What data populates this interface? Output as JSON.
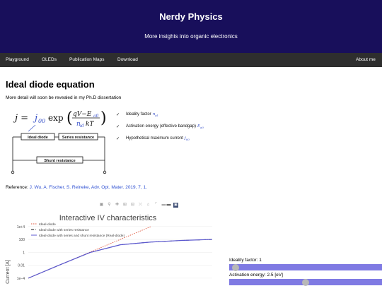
{
  "header": {
    "title": "Nerdy Physics",
    "subtitle": "More insights into organic electronics"
  },
  "nav": {
    "items": [
      "Playground",
      "OLEDs",
      "Publication Maps",
      "Download"
    ],
    "about": "About me"
  },
  "main": {
    "title": "Ideal diode equation",
    "intro": "More detail will soon be revealed in my Ph.D dissertation",
    "equation": {
      "lhs": "j = ",
      "prefactor": "j",
      "prefactor_sub": "00",
      "exp": "exp",
      "numerator": "qV−E",
      "numerator_sub": "a0",
      "denominator": "n",
      "denominator_sub": "id",
      "denominator_tail": "kT"
    },
    "circuit": {
      "ideal_diode": "Ideal diode",
      "series_resistance": "Series resistance",
      "shunt_resistance": "Shunt resistance"
    },
    "params": [
      {
        "check": "✓",
        "text": "Ideality factor",
        "symbol": "n",
        "symbol_sub": "id"
      },
      {
        "check": "✓",
        "text": "Activation energy (effective bandgap)",
        "symbol": "E",
        "symbol_sub": "a0"
      },
      {
        "check": "✓",
        "text": "Hypothetical maximum current",
        "symbol": "j",
        "symbol_sub": "00"
      }
    ],
    "reference": {
      "label": "Reference:",
      "link": "J. Wu, A. Fischer, S. Reineke, Adv. Opt. Mater. 2019, 7, 1."
    }
  },
  "toolbar": {
    "icons": [
      "camera-icon",
      "zoom-icon",
      "pan-icon",
      "zoom-in-icon",
      "zoom-out-icon",
      "autoscale-icon",
      "reset-axes-icon",
      "spike-lines-icon",
      "hover-closest-icon",
      "hover-compare-icon",
      "plotly-logo-icon"
    ]
  },
  "chart_data": {
    "type": "line",
    "title": "Interactive IV characteristics",
    "ylabel": "Current [A]",
    "xlabel": "",
    "y_scale": "log",
    "y_tick_labels": [
      "1e+4",
      "100",
      "1",
      "0.01",
      "1e−4"
    ],
    "legend_position": "top-left",
    "series": [
      {
        "name": "Ideal-diode",
        "style": "dotted",
        "color": "#e0553b",
        "x": [
          0,
          1,
          2,
          3,
          4
        ],
        "y": [
          0.0001,
          0.01,
          1,
          100,
          10000
        ]
      },
      {
        "name": "Ideal-diode with series resistance",
        "style": "dashdot",
        "color": "#111111",
        "x": [
          0,
          1,
          2,
          3,
          4,
          5,
          6
        ],
        "y": [
          0.0001,
          0.01,
          0.9,
          15,
          40,
          70,
          100
        ]
      },
      {
        "name": "Ideal-diode with series and shunt resistance (Real-diode)",
        "style": "solid",
        "color": "#5b58d0",
        "x": [
          0,
          1,
          2,
          3,
          4,
          5,
          6
        ],
        "y": [
          0.0001,
          0.01,
          0.9,
          15,
          40,
          70,
          100
        ]
      }
    ]
  },
  "sliders": [
    {
      "label": "Ideality factor: 1",
      "value_fraction": 0.02
    },
    {
      "label": "Activation energy: 2.5 [eV]",
      "value_fraction": 0.5
    }
  ]
}
